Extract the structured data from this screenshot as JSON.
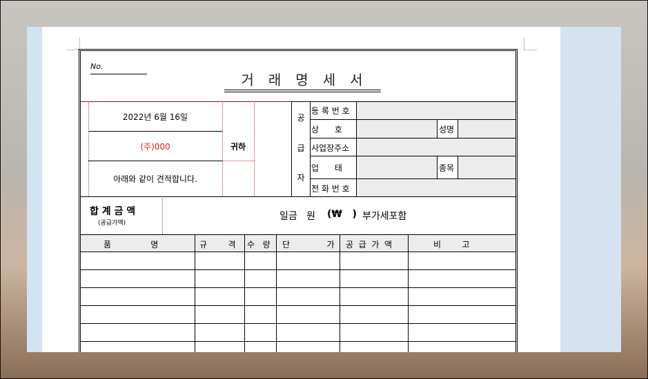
{
  "document": {
    "no_label": "No.",
    "title": "거래명세서",
    "date": "2022년 6월 16일",
    "recipient": "(주)000",
    "recipient_suffix": "귀하",
    "note": "아래와 같이 견적합니다.",
    "supplier_vertical": [
      "공",
      "급",
      "자"
    ],
    "supplier_fields": {
      "reg_no": "등 록 번 호",
      "company": "상      호",
      "name": "성명",
      "address": "사업장주소",
      "business_type": "업      태",
      "item_type": "종목",
      "phone": "전 화 번 호"
    },
    "total": {
      "label": "합 계 금 액",
      "sublabel": "(공급가액)",
      "amount_text": "일금   원",
      "won_symbol": "(₩   )",
      "vat_text": "부가세포함"
    },
    "table_headers": {
      "item": "품               명",
      "spec": "규        격",
      "qty": "수   량",
      "price": "단              가",
      "supply": "공  급  가  액",
      "remark": "비        고"
    },
    "empty_rows": 5
  }
}
